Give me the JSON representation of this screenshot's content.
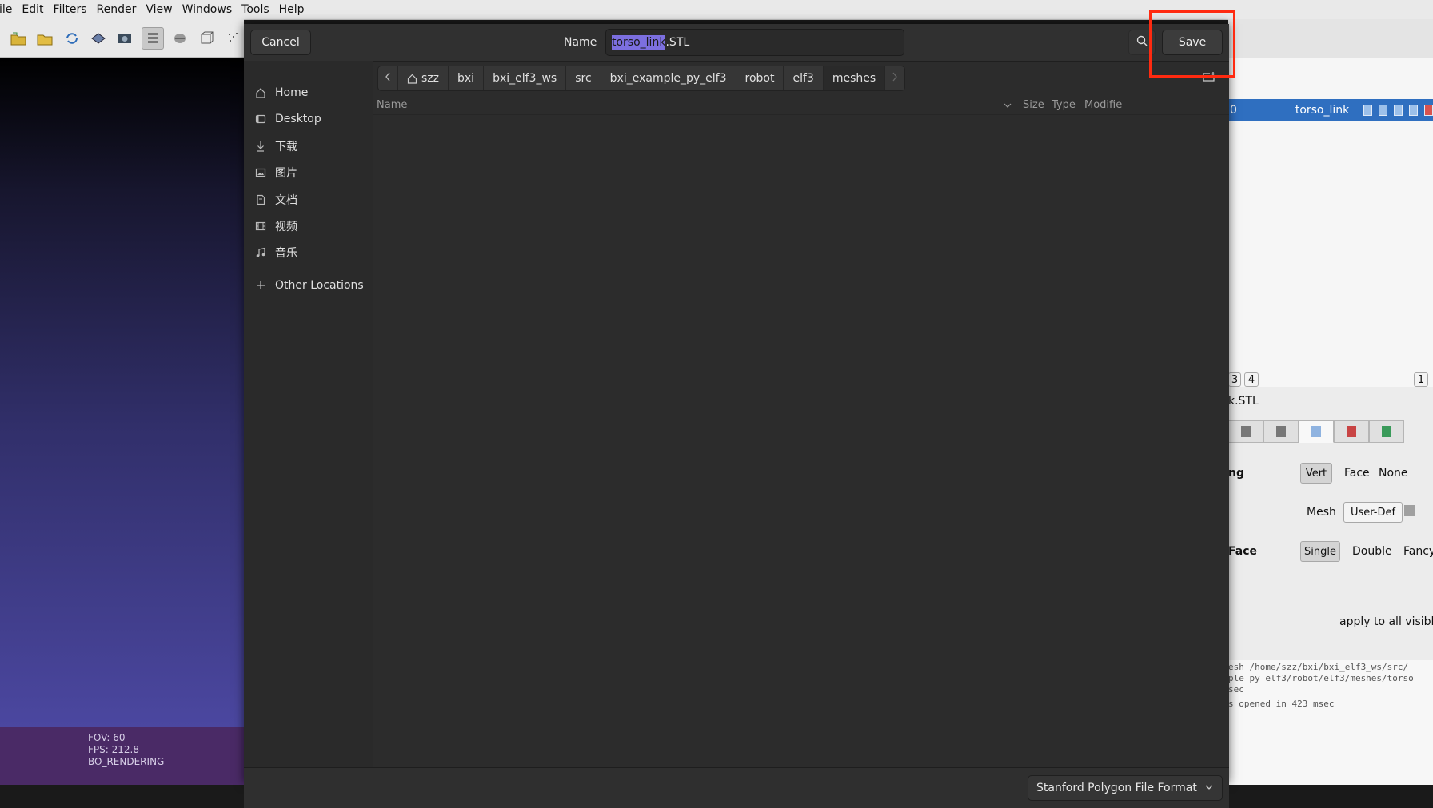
{
  "app": {
    "menu": [
      "ile",
      "Edit",
      "Filters",
      "Render",
      "View",
      "Windows",
      "Tools",
      "Help"
    ],
    "menu_mnemonics": [
      "i",
      "E",
      "F",
      "R",
      "V",
      "W",
      "T",
      "H"
    ],
    "viewport": {
      "fov": "FOV: 60",
      "fps": "FPS:   212.8",
      "mode": "BO_RENDERING"
    },
    "layer": {
      "index": "0",
      "name": "torso_link"
    },
    "page_buttons": [
      "3",
      "4",
      "1"
    ],
    "mesh_file": "k.STL",
    "shading": {
      "label": "ng",
      "options": [
        "Vert",
        "Face",
        "None"
      ],
      "selected": "Vert"
    },
    "color": {
      "label": "Mesh",
      "option": "User-Def"
    },
    "backface": {
      "label": "Face",
      "options": [
        "Single",
        "Double",
        "Fancy"
      ],
      "selected": "Single"
    },
    "apply_all": "apply to all visible",
    "log": [
      "esh /home/szz/bxi/bxi_elf3_ws/src/",
      "ple_py_elf3/robot/elf3/meshes/torso_",
      "sec",
      "s opened in 423 msec"
    ]
  },
  "dialog": {
    "cancel_label": "Cancel",
    "save_label": "Save",
    "name_label": "Name",
    "filename_selected": "torso_link",
    "filename_ext": ".STL",
    "places": [
      {
        "label": "Home",
        "icon": "home-icon"
      },
      {
        "label": "Desktop",
        "icon": "desktop-icon"
      },
      {
        "label": "下载",
        "icon": "download-icon"
      },
      {
        "label": "图片",
        "icon": "pictures-icon"
      },
      {
        "label": "文档",
        "icon": "documents-icon"
      },
      {
        "label": "视频",
        "icon": "video-icon"
      },
      {
        "label": "音乐",
        "icon": "music-icon"
      }
    ],
    "other_locations": "Other Locations",
    "path": [
      "szz",
      "bxi",
      "bxi_elf3_ws",
      "src",
      "bxi_example_py_elf3",
      "robot",
      "elf3",
      "meshes"
    ],
    "columns": {
      "name": "Name",
      "size": "Size",
      "type": "Type",
      "modified": "Modifie"
    },
    "file_type": "Stanford Polygon File Format",
    "colors": {
      "selection": "#7c6fe0",
      "highlight_box": "#ff2a10",
      "dialog_bg": "#2c2c2c"
    }
  }
}
